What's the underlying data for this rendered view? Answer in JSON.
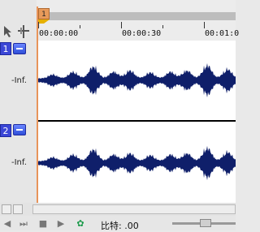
{
  "marker": {
    "label": "1"
  },
  "timeline": {
    "labels": [
      "00:00:00",
      "00:00:30",
      "00:01:0"
    ]
  },
  "tracks": [
    {
      "number": "1",
      "level_label": "-Inf."
    },
    {
      "number": "2",
      "level_label": "-Inf."
    }
  ],
  "transport": {
    "rate_label": "比特: .00"
  },
  "colors": {
    "waveform": "#0f1f6a",
    "cursor": "#e8945a",
    "track_badge": "#3b46d6"
  },
  "icons": {
    "tool_a": "cursor-icon",
    "tool_b": "snap-icon",
    "transport": [
      "skip-back-icon",
      "skip-forward-icon",
      "stop-icon",
      "play-icon",
      "loop-icon"
    ]
  }
}
